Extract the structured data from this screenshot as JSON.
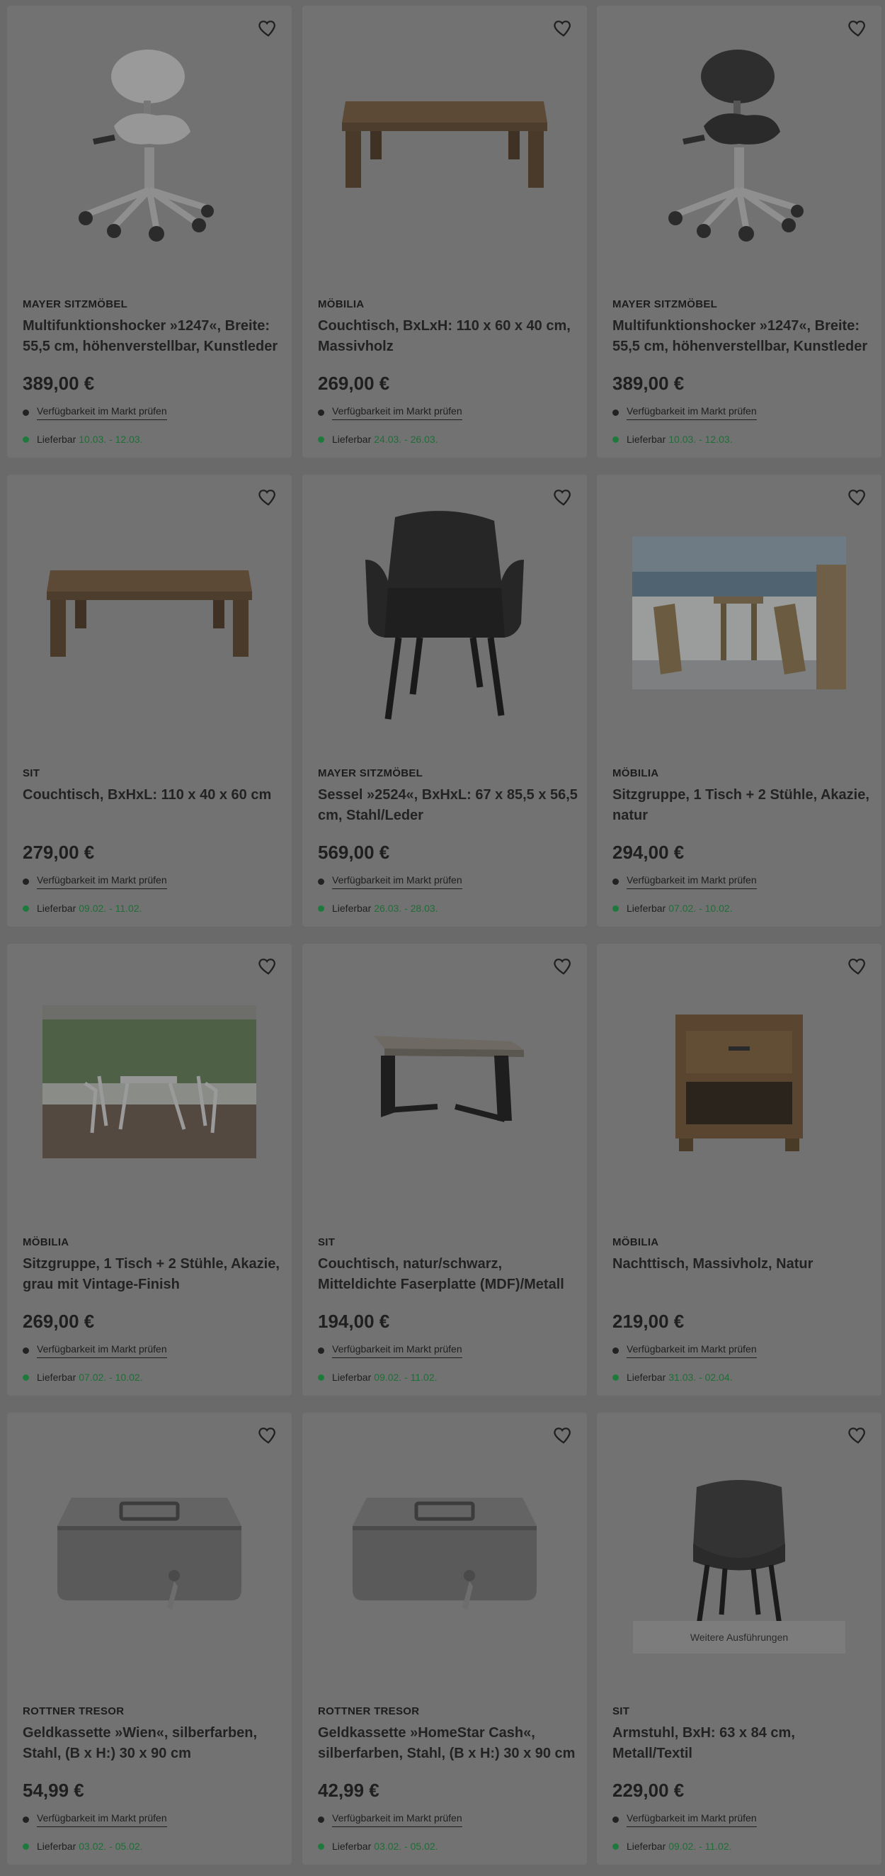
{
  "labels": {
    "availability": "Verfügbarkeit im Markt prüfen",
    "delivery": "Lieferbar"
  },
  "products": [
    {
      "brand": "MAYER SITZMÖBEL",
      "title": "Multifunktionshocker »1247«, Breite: 55,5 cm, höhenverstellbar, Kunstleder",
      "price": "389,00 €",
      "delivery": "10.03. - 12.03.",
      "image": "saddle-stool-white"
    },
    {
      "brand": "MÖBILIA",
      "title": "Couchtisch, BxLxH: 110 x 60 x 40 cm, Massivholz",
      "price": "269,00 €",
      "delivery": "24.03. - 26.03.",
      "image": "wood-coffee-table"
    },
    {
      "brand": "MAYER SITZMÖBEL",
      "title": "Multifunktionshocker »1247«, Breite: 55,5 cm, höhenverstellbar, Kunstleder",
      "price": "389,00 €",
      "delivery": "10.03. - 12.03.",
      "image": "saddle-stool-black"
    },
    {
      "brand": "SIT",
      "title": "Couchtisch, BxHxL: 110 x 40 x 60 cm",
      "price": "279,00 €",
      "delivery": "09.02. - 11.02.",
      "image": "wood-coffee-table"
    },
    {
      "brand": "MAYER SITZMÖBEL",
      "title": "Sessel »2524«, BxHxL: 67 x 85,5 x 56,5 cm, Stahl/Leder",
      "price": "569,00 €",
      "delivery": "26.03. - 28.03.",
      "image": "black-armchair"
    },
    {
      "brand": "MÖBILIA",
      "title": "Sitzgruppe, 1 Tisch + 2 Stühle, Akazie, natur",
      "price": "294,00 €",
      "delivery": "07.02. - 10.02.",
      "image": "terrace-set-photo"
    },
    {
      "brand": "MÖBILIA",
      "title": "Sitzgruppe, 1 Tisch + 2 Stühle, Akazie, grau mit Vintage-Finish",
      "price": "269,00 €",
      "delivery": "07.02. - 10.02.",
      "image": "veranda-set-photo"
    },
    {
      "brand": "SIT",
      "title": "Couchtisch, natur/schwarz, Mitteldichte Faserplatte (MDF)/Metall",
      "price": "194,00 €",
      "delivery": "09.02. - 11.02.",
      "image": "mdf-side-table"
    },
    {
      "brand": "MÖBILIA",
      "title": "Nachttisch, Massivholz, Natur",
      "price": "219,00 €",
      "delivery": "31.03. - 02.04.",
      "image": "nightstand"
    },
    {
      "brand": "ROTTNER TRESOR",
      "title": "Geldkassette »Wien«, silberfarben, Stahl, (B x H:) 30 x 90 cm",
      "price": "54,99 €",
      "delivery": "03.02. - 05.02.",
      "image": "cash-box"
    },
    {
      "brand": "ROTTNER TRESOR",
      "title": "Geldkassette »HomeStar Cash«, silberfarben, Stahl, (B x H:) 30 x 90 cm",
      "price": "42,99 €",
      "delivery": "03.02. - 05.02.",
      "image": "cash-box"
    },
    {
      "brand": "SIT",
      "title": "Armstuhl, BxH: 63 x 84 cm, Metall/Textil",
      "price": "229,00 €",
      "delivery": "09.02. - 11.02.",
      "image": "dining-armchair",
      "more": "Weitere Ausführungen"
    }
  ]
}
